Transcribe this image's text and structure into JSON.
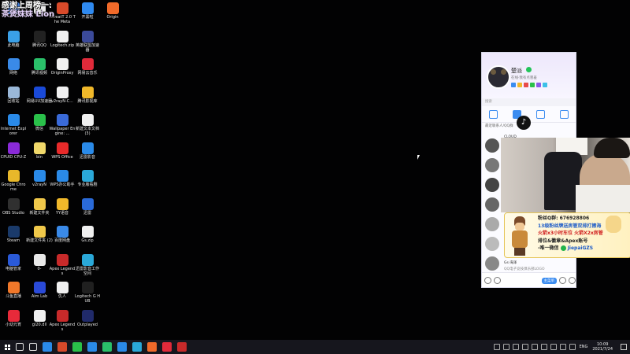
{
  "overlay": {
    "line1": "感谢上周榜一:",
    "line2": "茶煲妹妹 Lion"
  },
  "desktop_icons": [
    {
      "label": "",
      "color": "#3a78d6",
      "col": 0,
      "row": 0
    },
    {
      "label": "",
      "color": "#e8e8e8",
      "col": 1,
      "row": 0
    },
    {
      "label": "ThreatT 2.0 The Meta",
      "color": "#d84a2a",
      "col": 2,
      "row": 0
    },
    {
      "label": "开黑啦",
      "color": "#2f8af0",
      "col": 3,
      "row": 0
    },
    {
      "label": "Origin",
      "color": "#f06a2a",
      "col": 4,
      "row": 0
    },
    {
      "label": "此电脑",
      "color": "#3aa0e8",
      "col": 0,
      "row": 1
    },
    {
      "label": "腾讯QQ",
      "color": "#222222",
      "col": 1,
      "row": 1
    },
    {
      "label": "Logitech.zip",
      "color": "#f0f0f0",
      "col": 2,
      "row": 1
    },
    {
      "label": "英雄联盟加速器",
      "color": "#3b4a9a",
      "col": 3,
      "row": 1
    },
    {
      "label": "网络",
      "color": "#3a8ae8",
      "col": 0,
      "row": 2
    },
    {
      "label": "腾讯视频",
      "color": "#2ac06a",
      "col": 1,
      "row": 2
    },
    {
      "label": "OriginProxy",
      "color": "#f0f0f0",
      "col": 2,
      "row": 2
    },
    {
      "label": "网易云音乐",
      "color": "#e02a3a",
      "col": 3,
      "row": 2
    },
    {
      "label": "回收站",
      "color": "#9ab8d8",
      "col": 0,
      "row": 3
    },
    {
      "label": "网易UU加速器",
      "color": "#1a4ad8",
      "col": 1,
      "row": 3
    },
    {
      "label": "v2rayN-C...",
      "color": "#f0f0f0",
      "col": 2,
      "row": 3
    },
    {
      "label": "腾讯影视库",
      "color": "#f0b82a",
      "col": 3,
      "row": 3
    },
    {
      "label": "Internet Explorer",
      "color": "#2a8ae8",
      "col": 0,
      "row": 4
    },
    {
      "label": "微信",
      "color": "#2ac04a",
      "col": 1,
      "row": 4
    },
    {
      "label": "Wallpaper Engine: ...",
      "color": "#3a6ad8",
      "col": 2,
      "row": 4
    },
    {
      "label": "新建文本文档 (3)",
      "color": "#f0f0f0",
      "col": 3,
      "row": 4
    },
    {
      "label": "CPUID CPU-Z",
      "color": "#8a2ad8",
      "col": 0,
      "row": 5
    },
    {
      "label": "bin",
      "color": "#f0d86a",
      "col": 1,
      "row": 5
    },
    {
      "label": "WPS Office",
      "color": "#e82a2a",
      "col": 2,
      "row": 5
    },
    {
      "label": "迅雷影音",
      "color": "#2a8ae8",
      "col": 3,
      "row": 5
    },
    {
      "label": "Google Chrome",
      "color": "#e8b82a",
      "col": 0,
      "row": 6
    },
    {
      "label": "v2rayN",
      "color": "#2a8ae8",
      "col": 1,
      "row": 6
    },
    {
      "label": "WPS办公助手",
      "color": "#2a8ae8",
      "col": 2,
      "row": 6
    },
    {
      "label": "专业版看剧",
      "color": "#2aa8d8",
      "col": 3,
      "row": 6
    },
    {
      "label": "OBS Studio",
      "color": "#303030",
      "col": 0,
      "row": 7
    },
    {
      "label": "新建文件夹",
      "color": "#f0c84a",
      "col": 1,
      "row": 7
    },
    {
      "label": "YY语音",
      "color": "#f0b82a",
      "col": 2,
      "row": 7
    },
    {
      "label": "迅雷",
      "color": "#2a6ad8",
      "col": 3,
      "row": 7
    },
    {
      "label": "Steam",
      "color": "#1a3a6a",
      "col": 0,
      "row": 8
    },
    {
      "label": "新建文件夹 (2)",
      "color": "#f0c84a",
      "col": 1,
      "row": 8
    },
    {
      "label": "百度网盘",
      "color": "#3a8ae8",
      "col": 2,
      "row": 8
    },
    {
      "label": "Gs.zip",
      "color": "#f0f0f0",
      "col": 3,
      "row": 8
    },
    {
      "label": "电脑管家",
      "color": "#2a5ad8",
      "col": 0,
      "row": 9
    },
    {
      "label": "0-",
      "color": "#e8e8e8",
      "col": 1,
      "row": 9
    },
    {
      "label": "Apex Legends",
      "color": "#c82a2a",
      "col": 2,
      "row": 9
    },
    {
      "label": "迅雷影音工作空间",
      "color": "#2aa8d8",
      "col": 3,
      "row": 9
    },
    {
      "label": "斗鱼直播",
      "color": "#f0782a",
      "col": 0,
      "row": 10
    },
    {
      "label": "Aim Lab",
      "color": "#2a4ad8",
      "col": 1,
      "row": 10
    },
    {
      "label": "仇人",
      "color": "#f0f0f0",
      "col": 2,
      "row": 10
    },
    {
      "label": "Logitech G HUB",
      "color": "#202020",
      "col": 3,
      "row": 10
    },
    {
      "label": "小幼元宵",
      "color": "#e82a3a",
      "col": 0,
      "row": 11
    },
    {
      "label": "gl20.dll",
      "color": "#f0f0f0",
      "col": 1,
      "row": 11
    },
    {
      "label": "Apex Legends",
      "color": "#c82a2a",
      "col": 2,
      "row": 11
    },
    {
      "label": "Outplayed",
      "color": "#202a6a",
      "col": 3,
      "row": 11
    }
  ],
  "chat": {
    "name": "楚派",
    "status": "在线·我有点害羞",
    "search_hint": "搜索",
    "recent_label": "最近联系人/QQ群",
    "contacts": [
      {
        "label": "CLOUD",
        "color": "#555"
      },
      {
        "label": "",
        "color": "#777"
      },
      {
        "label": "",
        "color": "#444"
      },
      {
        "label": "",
        "color": "#666"
      },
      {
        "label": "",
        "color": "#aaa"
      },
      {
        "label": "",
        "color": "#bbb"
      },
      {
        "label": "Gs·海泽",
        "color": "#888"
      }
    ],
    "last_message": "QQ电子竞技俱乐部LOGO",
    "footer_button": "主菜单"
  },
  "promo": {
    "line1": "粉丝Q群: 676928806",
    "line2": "13级粉丝牌送房管双排打擦海",
    "line3": "火箭x3小时车位 火箭X2x房管",
    "line4": "排位&徽章&Apex账号",
    "line5": "-唯一微信",
    "wechat_id": "JiepaiGZS"
  },
  "taskbar": {
    "lang": "ENG",
    "time": "10:09",
    "date": "2021/7/24",
    "icons": [
      {
        "name": "search-icon",
        "color": "#ddd"
      },
      {
        "name": "task-view-icon",
        "color": "#ddd"
      },
      {
        "name": "edge-icon",
        "color": "#2a8ae8"
      },
      {
        "name": "app-icon",
        "color": "#d84a2a"
      },
      {
        "name": "wechat-icon",
        "color": "#2ac04a"
      },
      {
        "name": "chat-icon",
        "color": "#2a8ae8"
      },
      {
        "name": "tencent-video-icon",
        "color": "#2ac06a"
      },
      {
        "name": "file-icon",
        "color": "#2a8ae8"
      },
      {
        "name": "app-icon-2",
        "color": "#2aa8d8"
      },
      {
        "name": "origin-icon",
        "color": "#f06a2a"
      },
      {
        "name": "netease-icon",
        "color": "#e02a3a"
      },
      {
        "name": "apex-icon",
        "color": "#c82a2a"
      }
    ]
  }
}
